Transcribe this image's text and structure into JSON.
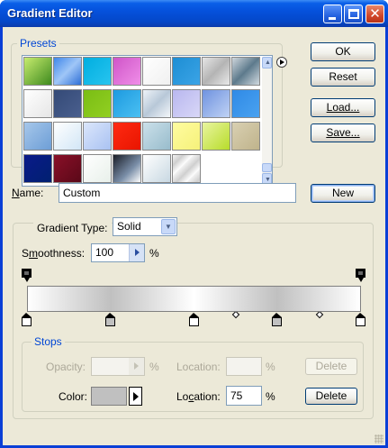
{
  "window": {
    "title": "Gradient Editor",
    "controls": [
      "minimize-icon",
      "maximize-icon",
      "close-icon"
    ]
  },
  "presets": {
    "label": "Presets",
    "menu_icon": "play-circle-icon",
    "swatches": [
      {
        "row": 0,
        "col": 0,
        "css": "linear-gradient(135deg,#c7ec6e,#3e8a1e)"
      },
      {
        "row": 0,
        "col": 1,
        "css": "linear-gradient(135deg,#3f87ea,#9fc6f7 50%,#2d6ed6)"
      },
      {
        "row": 0,
        "col": 2,
        "css": "linear-gradient(135deg,#00aee0,#28c4ef)"
      },
      {
        "row": 0,
        "col": 3,
        "css": "linear-gradient(135deg,#cf54c8,#f08fe8)"
      },
      {
        "row": 0,
        "col": 4,
        "css": "linear-gradient(135deg,#ffffff,#f0f0f0)"
      },
      {
        "row": 0,
        "col": 5,
        "css": "linear-gradient(135deg,#1d8ed4,#3ba4e6)"
      },
      {
        "row": 0,
        "col": 6,
        "css": "linear-gradient(135deg,#e6e6e6,#b4b4b4 50%,#eaeaea)"
      },
      {
        "row": 0,
        "col": 7,
        "css": "linear-gradient(135deg,#cfd6dc,#5d7a8c 50%,#d2dae0)"
      },
      {
        "row": 1,
        "col": 0,
        "css": "linear-gradient(135deg,#ffffff,#e6e6e6)"
      },
      {
        "row": 1,
        "col": 1,
        "css": "linear-gradient(135deg,#344a77,#4a5f8e)"
      },
      {
        "row": 1,
        "col": 2,
        "css": "linear-gradient(135deg,#7abd14,#92cf22)"
      },
      {
        "row": 1,
        "col": 3,
        "css": "linear-gradient(135deg,#1d9ae0,#4bc0f2)"
      },
      {
        "row": 1,
        "col": 4,
        "css": "linear-gradient(135deg,#eef3f8,#b8c8d8 50%,#f4f7fa)"
      },
      {
        "row": 1,
        "col": 5,
        "css": "linear-gradient(135deg,#b9b7ef,#d8d7f7)"
      },
      {
        "row": 1,
        "col": 6,
        "css": "linear-gradient(135deg,#6f93e0,#c0d2f4)"
      },
      {
        "row": 1,
        "col": 7,
        "css": "linear-gradient(135deg,#2f8ae6,#4aa2f0)"
      },
      {
        "row": 2,
        "col": 0,
        "css": "linear-gradient(135deg,#a6c7ea,#6d9ed6)"
      },
      {
        "row": 2,
        "col": 1,
        "css": "linear-gradient(135deg,#ffffff,#d2e6f6)"
      },
      {
        "row": 2,
        "col": 2,
        "css": "linear-gradient(135deg,#dbe6fb,#a9c2f2)"
      },
      {
        "row": 2,
        "col": 3,
        "css": "linear-gradient(135deg,#ff2a12,#e81500)"
      },
      {
        "row": 2,
        "col": 4,
        "css": "linear-gradient(135deg,#cbe0ea,#98bccc)"
      },
      {
        "row": 2,
        "col": 5,
        "css": "linear-gradient(135deg,#fffca0,#f5f17a)"
      },
      {
        "row": 2,
        "col": 6,
        "css": "linear-gradient(135deg,#e9f5a0,#b7dc2a)"
      },
      {
        "row": 2,
        "col": 7,
        "css": "linear-gradient(135deg,#d9d0b2,#bfb38b)"
      },
      {
        "row": 3,
        "col": 0,
        "css": "linear-gradient(135deg,#0a1a8a,#002070)"
      },
      {
        "row": 3,
        "col": 1,
        "css": "linear-gradient(135deg,#8a1028,#5a0818)"
      },
      {
        "row": 3,
        "col": 2,
        "css": "linear-gradient(135deg,#ffffff,#e8f0ea)"
      },
      {
        "row": 3,
        "col": 3,
        "css": "linear-gradient(135deg,#1a1e28,#7a8ea8 60%,#ffffff)"
      },
      {
        "row": 3,
        "col": 4,
        "css": "linear-gradient(135deg,#ffffff,#c8d8e2)"
      },
      {
        "row": 3,
        "col": 5,
        "css": "repeating-linear-gradient(135deg,#f4f4f4 0,#cfcfcf 8px,#ffffff 16px)"
      }
    ],
    "scrollbar": {
      "up_icon": "arrow-up-icon",
      "down_icon": "arrow-down-icon"
    }
  },
  "buttons": {
    "ok": "OK",
    "reset": "Reset",
    "load": "Load...",
    "save": "Save...",
    "new": "New"
  },
  "name": {
    "label": "Name:",
    "value": "Custom"
  },
  "gradient": {
    "type_label": "Gradient Type:",
    "type_value": "Solid",
    "smoothness_label": "Smoothness:",
    "smoothness_value": "100",
    "percent": "%",
    "colors": {
      "light": "#ffffff",
      "gray": "#c0c0c0"
    },
    "opacity_stops": [
      0,
      100
    ],
    "color_stops": [
      {
        "position": 0,
        "color": "white"
      },
      {
        "position": 25,
        "color": "gray"
      },
      {
        "position": 50,
        "color": "white"
      },
      {
        "position": 75,
        "color": "gray"
      },
      {
        "position": 100,
        "color": "white"
      }
    ],
    "midpoints": [
      62.5,
      87.5
    ]
  },
  "stops": {
    "label": "Stops",
    "opacity_label": "Opacity:",
    "opacity_value": "",
    "opacity_location_label": "Location:",
    "opacity_location_value": "",
    "delete_label": "Delete",
    "color_label": "Color:",
    "color_value": "#c0c0c0",
    "color_menu_icon": "triangle-right-icon",
    "location_label": "Location:",
    "location_value": "75"
  }
}
